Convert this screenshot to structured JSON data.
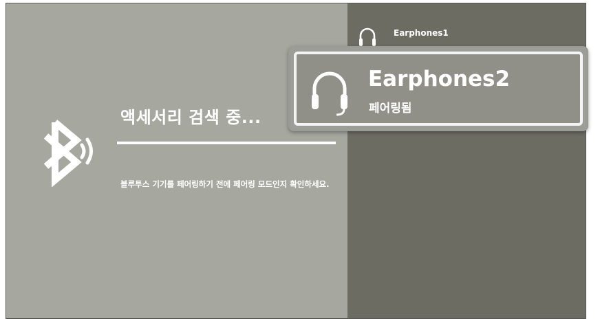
{
  "search_panel": {
    "title": "액세서리 검색 중...",
    "instructions": "블루투스 기기를 페어링하기 전에 페어링 모드인지 확인하세요.",
    "icon": "bluetooth-searching-icon"
  },
  "devices": [
    {
      "name": "Earphones1",
      "status": "",
      "icon": "headphones-icon",
      "selected": false
    },
    {
      "name": "Earphones2",
      "status": "페어링됨",
      "icon": "headphones-icon",
      "selected": true
    }
  ],
  "colors": {
    "left_pane": "#a6a8a0",
    "right_pane": "#6d6c63",
    "selected_card": "#909089",
    "text": "#ffffff",
    "focus_border": "#f4f4f4"
  }
}
